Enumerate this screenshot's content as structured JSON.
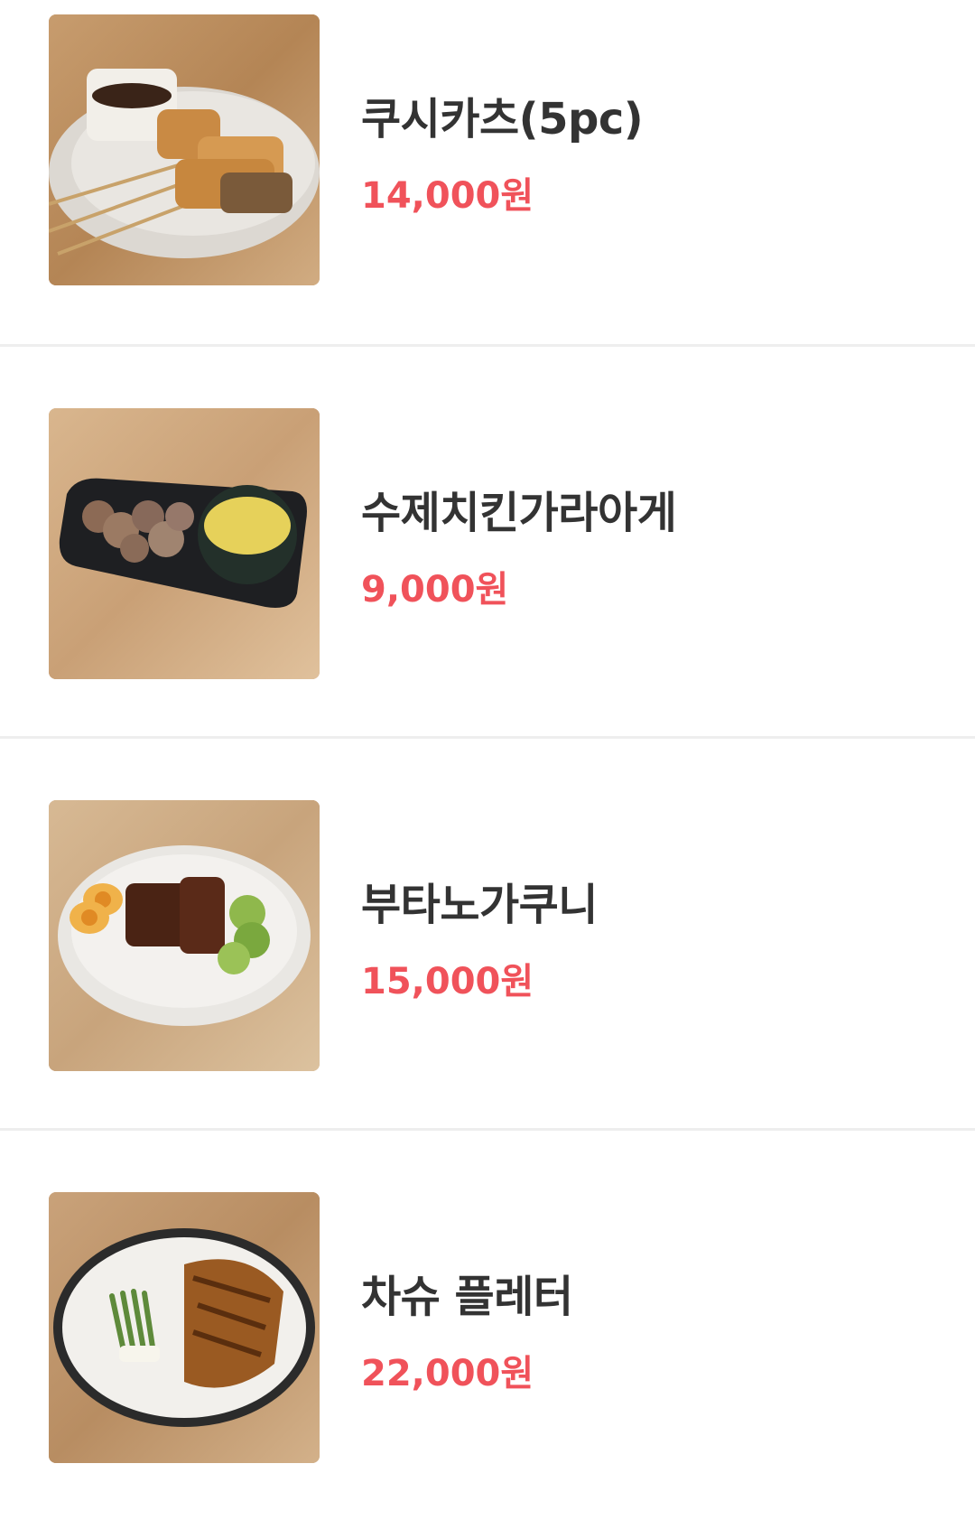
{
  "colors": {
    "price": "#f0525a",
    "name": "#333333",
    "divider": "#eeeeee",
    "background": "#ffffff"
  },
  "menu": {
    "items": [
      {
        "name": "쿠시카츠(5pc)",
        "price": "14,000원",
        "image_icon": "food-photo-kushikatsu"
      },
      {
        "name": "수제치킨가라아게",
        "price": "9,000원",
        "image_icon": "food-photo-karaage"
      },
      {
        "name": "부타노가쿠니",
        "price": "15,000원",
        "image_icon": "food-photo-butanokakuni"
      },
      {
        "name": "차슈 플레터",
        "price": "22,000원",
        "image_icon": "food-photo-chashu-platter"
      }
    ]
  }
}
